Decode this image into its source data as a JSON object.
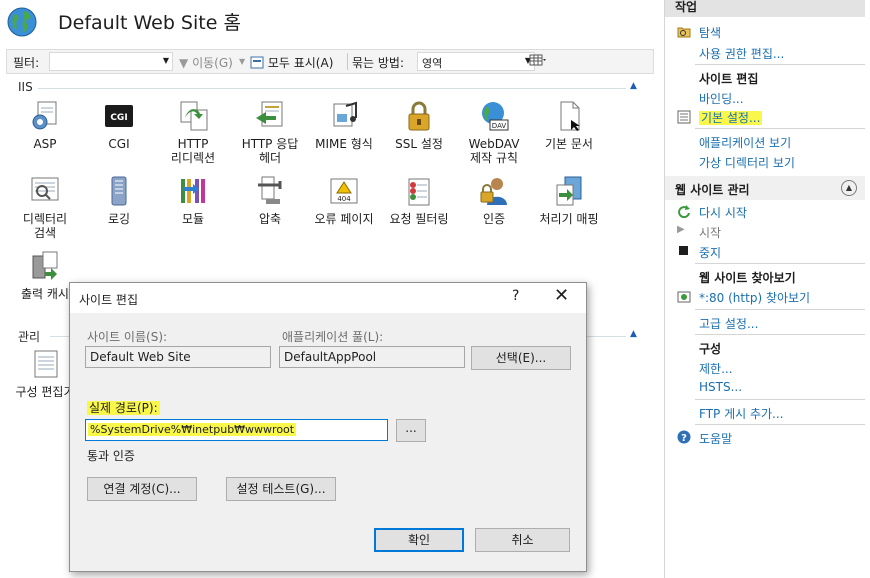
{
  "header": {
    "title": "Default Web Site 홈"
  },
  "toolbar": {
    "filter_label": "필터:",
    "go_label": "이동(G)",
    "show_all_label": "모두 표시(A)",
    "groupby_label": "묶는 방법:",
    "groupby_value": "영역"
  },
  "groups": {
    "iis": "IIS",
    "management": "관리"
  },
  "features": {
    "asp": "ASP",
    "cgi": "CGI",
    "http_redirect": "HTTP\n리디렉션",
    "http_response_headers": "HTTP 응답\n헤더",
    "mime_types": "MIME 형식",
    "ssl": "SSL 설정",
    "webdav": "WebDAV\n제작 규칙",
    "default_document": "기본 문서",
    "directory_browsing": "디렉터리\n검색",
    "logging": "로깅",
    "modules": "모듈",
    "compression": "압축",
    "error_pages": "오류 페이지",
    "request_filtering": "요청 필터링",
    "authentication": "인증",
    "handler_mappings": "처리기 매핑",
    "output_caching": "출력 캐시",
    "config_editor": "구성 편집기"
  },
  "icons": {
    "cgi_text": "CGI",
    "error_page_text": "404",
    "webdav_text": "DAV"
  },
  "actions": {
    "title": "작업",
    "explore": "탐색",
    "edit_permissions": "사용 권한 편집...",
    "edit_site_header": "사이트 편집",
    "bindings": "바인딩...",
    "basic_settings": "기본 설정...",
    "view_applications": "애플리케이션 보기",
    "view_virtual_dirs": "가상 디렉터리 보기",
    "manage_site_header": "웹 사이트 관리",
    "restart": "다시 시작",
    "start": "시작",
    "stop": "중지",
    "browse_header": "웹 사이트 찾아보기",
    "browse_80": "*:80 (http) 찾아보기",
    "advanced_settings": "고급 설정...",
    "configure_header": "구성",
    "limits": "제한...",
    "hsts": "HSTS...",
    "ftp_publishing": "FTP 게시 추가...",
    "help": "도움말"
  },
  "dialog": {
    "title": "사이트 편집",
    "help_glyph": "?",
    "close_glyph": "✕",
    "site_name_label": "사이트 이름(S):",
    "site_name_value": "Default Web Site",
    "app_pool_label": "애플리케이션 풀(L):",
    "app_pool_value": "DefaultAppPool",
    "select_button": "선택(E)...",
    "physical_path_label": "실제 경로(P):",
    "physical_path_value": "%SystemDrive%₩inetpub₩wwwroot",
    "browse_button": "...",
    "pass_through_label": "통과 인증",
    "connect_as_button": "연결 계정(C)...",
    "test_settings_button": "설정 테스트(G)...",
    "ok_button": "확인",
    "cancel_button": "취소"
  },
  "colors": {
    "link": "#1a6fb0",
    "highlight": "#f8f74a",
    "accent": "#0078d7"
  }
}
